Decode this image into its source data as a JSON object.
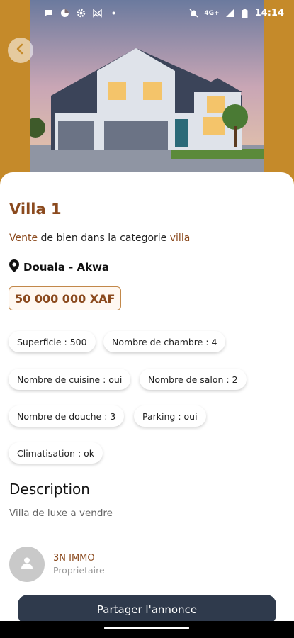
{
  "status_bar": {
    "time": "14:14",
    "network": "4G+",
    "left_icons": [
      "chat-bubble-icon",
      "pie-icon",
      "gear-icon",
      "mail-icon",
      "dot-icon"
    ],
    "right_icons": [
      "mute-icon",
      "signal-icon",
      "battery-icon"
    ]
  },
  "listing": {
    "title": "Villa 1",
    "category_prefix": "Vente",
    "category_middle": " de bien dans la categorie ",
    "category_value": "villa",
    "location": "Douala - Akwa",
    "price": "50 000 000 XAF"
  },
  "features": [
    "Superficie : 500",
    "Nombre de chambre : 4",
    "Nombre de cuisine : oui",
    "Nombre de salon : 2",
    "Nombre de douche : 3",
    "Parking : oui",
    "Climatisation : ok"
  ],
  "description": {
    "title": "Description",
    "text": "Villa de luxe a vendre"
  },
  "owner": {
    "name": "3N IMMO",
    "role": "Proprietaire"
  },
  "actions": {
    "share_label": "Partager l'annonce"
  },
  "colors": {
    "accent": "#8b4a1e",
    "hero_background": "#c58a2a",
    "button": "#2f3a4c"
  }
}
